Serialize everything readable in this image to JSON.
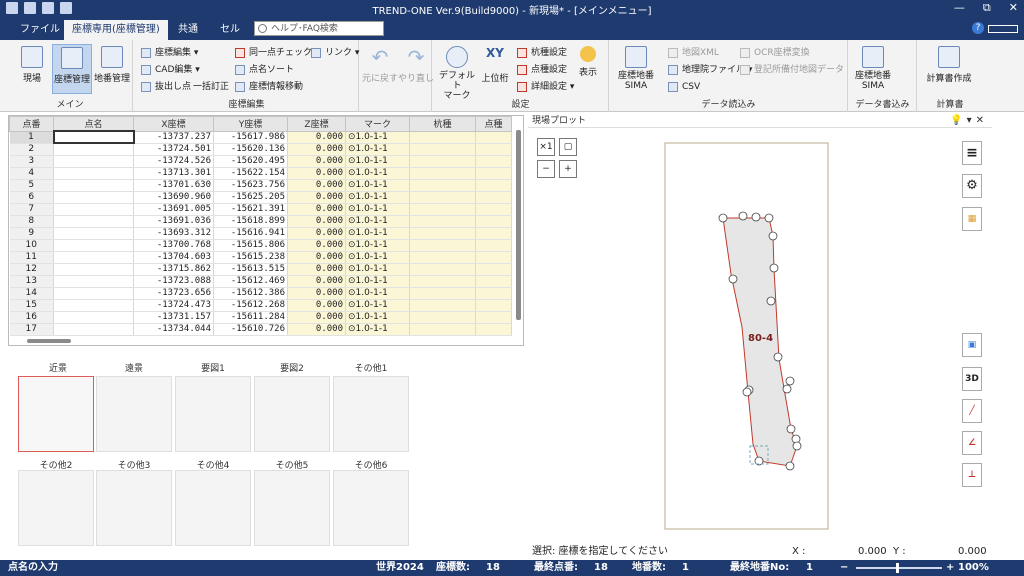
{
  "window": {
    "title": "TREND-ONE Ver.9(Build9000) - 新現場* - [メインメニュー]",
    "controls": [
      "—",
      "⧉",
      "✕"
    ]
  },
  "menu": {
    "tabs": [
      "ファイル",
      "座標専用(座標管理)",
      "共通",
      "セル"
    ],
    "help_placeholder": "ヘルプ･FAQ検索",
    "help_q": "?"
  },
  "ribbon": {
    "main": {
      "label": "メイン",
      "buttons": [
        "現場",
        "座標管理",
        "地番管理"
      ]
    },
    "edit": {
      "label": "座標編集",
      "items": [
        "座標編集",
        "CAD編集",
        "抜出し点",
        "一括訂正",
        "同一点チェック",
        "点名ソート",
        "座標情報移動",
        "リンク"
      ]
    },
    "undo": {
      "undo": "元に戻す",
      "redo": "やり直し"
    },
    "settings": {
      "label": "設定",
      "default_mark": "デフォルト\nマーク",
      "upper": "上位桁",
      "xy": "XY",
      "items": [
        "杭種設定",
        "点種設定",
        "詳細設定"
      ],
      "display": "表示"
    },
    "import": {
      "label": "データ読込み",
      "sima": "座標地番\nSIMA",
      "items": [
        "地図XML",
        "地理院ファイル",
        "CSV",
        "OCR座標変換",
        "登記所備付地図データ"
      ]
    },
    "export": {
      "label": "データ書込み",
      "sima": "座標地番\nSIMA"
    },
    "report": {
      "label": "計算書",
      "create": "計算書作成"
    }
  },
  "grid": {
    "headers": [
      "点番",
      "点名",
      "X座標",
      "Y座標",
      "Z座標",
      "マーク",
      "杭種",
      "点種"
    ],
    "rows": [
      {
        "no": "1",
        "name": "",
        "x": "-13737.237",
        "y": "-15617.986",
        "z": "0.000",
        "mark": "⊙1.0-1-1"
      },
      {
        "no": "2",
        "name": "",
        "x": "-13724.501",
        "y": "-15620.136",
        "z": "0.000",
        "mark": "⊙1.0-1-1"
      },
      {
        "no": "3",
        "name": "",
        "x": "-13724.526",
        "y": "-15620.495",
        "z": "0.000",
        "mark": "⊙1.0-1-1"
      },
      {
        "no": "4",
        "name": "",
        "x": "-13713.301",
        "y": "-15622.154",
        "z": "0.000",
        "mark": "⊙1.0-1-1"
      },
      {
        "no": "5",
        "name": "",
        "x": "-13701.630",
        "y": "-15623.756",
        "z": "0.000",
        "mark": "⊙1.0-1-1"
      },
      {
        "no": "6",
        "name": "",
        "x": "-13690.960",
        "y": "-15625.205",
        "z": "0.000",
        "mark": "⊙1.0-1-1"
      },
      {
        "no": "7",
        "name": "",
        "x": "-13691.005",
        "y": "-15621.391",
        "z": "0.000",
        "mark": "⊙1.0-1-1"
      },
      {
        "no": "8",
        "name": "",
        "x": "-13691.036",
        "y": "-15618.899",
        "z": "0.000",
        "mark": "⊙1.0-1-1"
      },
      {
        "no": "9",
        "name": "",
        "x": "-13693.312",
        "y": "-15616.941",
        "z": "0.000",
        "mark": "⊙1.0-1-1"
      },
      {
        "no": "10",
        "name": "",
        "x": "-13700.768",
        "y": "-15615.806",
        "z": "0.000",
        "mark": "⊙1.0-1-1"
      },
      {
        "no": "11",
        "name": "",
        "x": "-13704.603",
        "y": "-15615.238",
        "z": "0.000",
        "mark": "⊙1.0-1-1"
      },
      {
        "no": "12",
        "name": "",
        "x": "-13715.862",
        "y": "-15613.515",
        "z": "0.000",
        "mark": "⊙1.0-1-1"
      },
      {
        "no": "13",
        "name": "",
        "x": "-13723.088",
        "y": "-15612.469",
        "z": "0.000",
        "mark": "⊙1.0-1-1"
      },
      {
        "no": "14",
        "name": "",
        "x": "-13723.656",
        "y": "-15612.386",
        "z": "0.000",
        "mark": "⊙1.0-1-1"
      },
      {
        "no": "15",
        "name": "",
        "x": "-13724.473",
        "y": "-15612.268",
        "z": "0.000",
        "mark": "⊙1.0-1-1"
      },
      {
        "no": "16",
        "name": "",
        "x": "-13731.157",
        "y": "-15611.284",
        "z": "0.000",
        "mark": "⊙1.0-1-1"
      },
      {
        "no": "17",
        "name": "",
        "x": "-13734.044",
        "y": "-15610.726",
        "z": "0.000",
        "mark": "⊙1.0-1-1"
      }
    ]
  },
  "thumbnails": {
    "row1": [
      "近景",
      "遠景",
      "要図1",
      "要図2",
      "その他1"
    ],
    "row2": [
      "その他2",
      "その他3",
      "その他4",
      "その他5",
      "その他6"
    ]
  },
  "plot_panel": {
    "title": "現場プロット",
    "parcel_label": "80-4",
    "zoom_buttons": [
      "×1",
      "−",
      "+"
    ],
    "right_tools": [
      "3D"
    ]
  },
  "selection_bar": {
    "message": "選択: 座標を指定してください",
    "x_label": "X :",
    "x_value": "0.000",
    "y_label": "Y :",
    "y_value": "0.000"
  },
  "status": {
    "mode": "点名の入力",
    "world": "世界2024",
    "coord_count_label": "座標数:",
    "coord_count": "18",
    "last_point_label": "最終点番:",
    "last_point": "18",
    "parcel_count_label": "地番数:",
    "parcel_count": "1",
    "last_parcel_label": "最終地番No:",
    "last_parcel": "1",
    "zoom_minus": "−",
    "zoom_plus": "+",
    "zoom": "100%"
  },
  "colors": {
    "title_bar": "#1f3a6e",
    "accent_blue": "#3a7bd5",
    "grid_yellow": "#fbf7d6",
    "parcel_fill": "#e6e6e6",
    "parcel_stroke": "#c0392b"
  }
}
